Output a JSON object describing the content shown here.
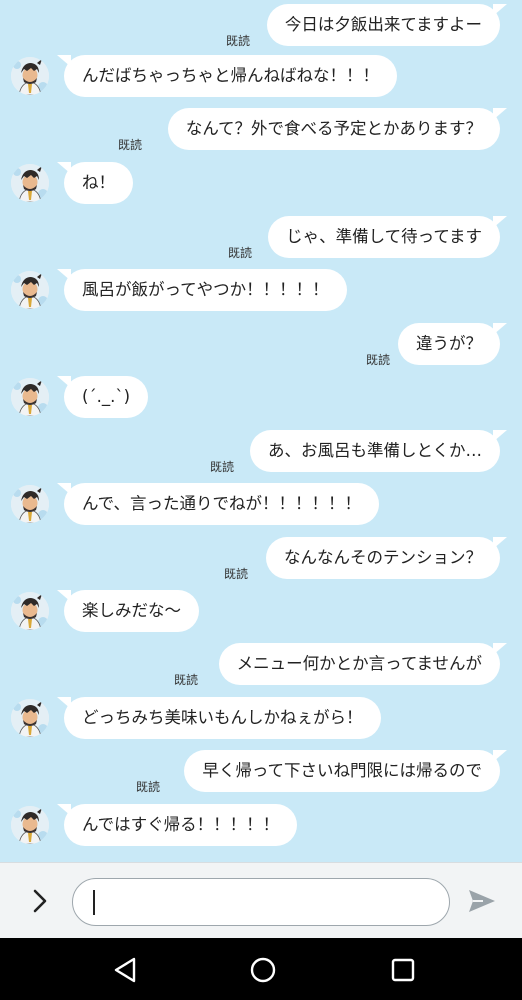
{
  "chat": {
    "read_label": "既読",
    "messages": [
      {
        "side": "sent",
        "text": "今日は夕飯出来てますよー"
      },
      {
        "side": "recv",
        "text": "んだばちゃっちゃと帰んねばねな！！！"
      },
      {
        "side": "sent",
        "text": "なんて？外で食べる予定とかあります？"
      },
      {
        "side": "recv",
        "text": "ね！"
      },
      {
        "side": "sent",
        "text": "じゃ、準備して待ってます"
      },
      {
        "side": "recv",
        "text": "風呂が飯がってやつか！！！！！"
      },
      {
        "side": "sent",
        "text": "違うが？"
      },
      {
        "side": "recv",
        "text": "(´._.`)"
      },
      {
        "side": "sent",
        "text": "あ、お風呂も準備しとくか…"
      },
      {
        "side": "recv",
        "text": "んで、言った通りでねが！！！！！！"
      },
      {
        "side": "sent",
        "text": "なんなんそのテンション？"
      },
      {
        "side": "recv",
        "text": "楽しみだな〜"
      },
      {
        "side": "sent",
        "text": "メニュー何かとか言ってませんが"
      },
      {
        "side": "recv",
        "text": "どっちみち美味いもんしかねぇがら！"
      },
      {
        "side": "sent",
        "text": "早く帰って下さいね門限には帰るので"
      },
      {
        "side": "recv",
        "text": "んではすぐ帰る！！！！！"
      }
    ]
  },
  "input": {
    "value": "",
    "expand_icon": "chevron-right-icon",
    "send_icon": "send-icon"
  },
  "navbar": {
    "icons": [
      "back-triangle-icon",
      "home-circle-icon",
      "recents-square-icon"
    ]
  },
  "colors": {
    "chat_background": "#c9e9f7",
    "bubble": "#ffffff",
    "navbar": "#000000"
  }
}
